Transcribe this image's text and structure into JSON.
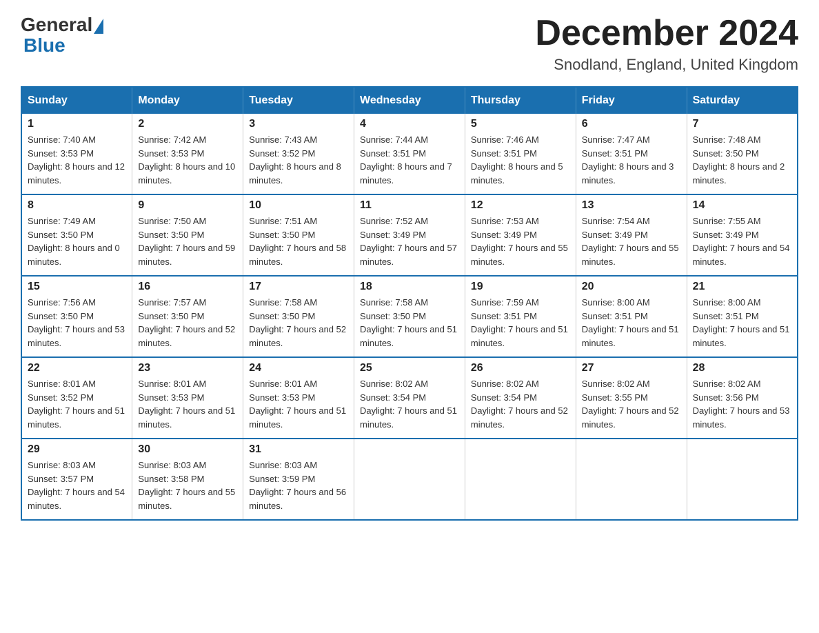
{
  "header": {
    "logo_general": "General",
    "logo_blue": "Blue",
    "title": "December 2024",
    "subtitle": "Snodland, England, United Kingdom"
  },
  "weekdays": [
    "Sunday",
    "Monday",
    "Tuesday",
    "Wednesday",
    "Thursday",
    "Friday",
    "Saturday"
  ],
  "weeks": [
    [
      {
        "day": "1",
        "sunrise": "7:40 AM",
        "sunset": "3:53 PM",
        "daylight": "8 hours and 12 minutes."
      },
      {
        "day": "2",
        "sunrise": "7:42 AM",
        "sunset": "3:53 PM",
        "daylight": "8 hours and 10 minutes."
      },
      {
        "day": "3",
        "sunrise": "7:43 AM",
        "sunset": "3:52 PM",
        "daylight": "8 hours and 8 minutes."
      },
      {
        "day": "4",
        "sunrise": "7:44 AM",
        "sunset": "3:51 PM",
        "daylight": "8 hours and 7 minutes."
      },
      {
        "day": "5",
        "sunrise": "7:46 AM",
        "sunset": "3:51 PM",
        "daylight": "8 hours and 5 minutes."
      },
      {
        "day": "6",
        "sunrise": "7:47 AM",
        "sunset": "3:51 PM",
        "daylight": "8 hours and 3 minutes."
      },
      {
        "day": "7",
        "sunrise": "7:48 AM",
        "sunset": "3:50 PM",
        "daylight": "8 hours and 2 minutes."
      }
    ],
    [
      {
        "day": "8",
        "sunrise": "7:49 AM",
        "sunset": "3:50 PM",
        "daylight": "8 hours and 0 minutes."
      },
      {
        "day": "9",
        "sunrise": "7:50 AM",
        "sunset": "3:50 PM",
        "daylight": "7 hours and 59 minutes."
      },
      {
        "day": "10",
        "sunrise": "7:51 AM",
        "sunset": "3:50 PM",
        "daylight": "7 hours and 58 minutes."
      },
      {
        "day": "11",
        "sunrise": "7:52 AM",
        "sunset": "3:49 PM",
        "daylight": "7 hours and 57 minutes."
      },
      {
        "day": "12",
        "sunrise": "7:53 AM",
        "sunset": "3:49 PM",
        "daylight": "7 hours and 55 minutes."
      },
      {
        "day": "13",
        "sunrise": "7:54 AM",
        "sunset": "3:49 PM",
        "daylight": "7 hours and 55 minutes."
      },
      {
        "day": "14",
        "sunrise": "7:55 AM",
        "sunset": "3:49 PM",
        "daylight": "7 hours and 54 minutes."
      }
    ],
    [
      {
        "day": "15",
        "sunrise": "7:56 AM",
        "sunset": "3:50 PM",
        "daylight": "7 hours and 53 minutes."
      },
      {
        "day": "16",
        "sunrise": "7:57 AM",
        "sunset": "3:50 PM",
        "daylight": "7 hours and 52 minutes."
      },
      {
        "day": "17",
        "sunrise": "7:58 AM",
        "sunset": "3:50 PM",
        "daylight": "7 hours and 52 minutes."
      },
      {
        "day": "18",
        "sunrise": "7:58 AM",
        "sunset": "3:50 PM",
        "daylight": "7 hours and 51 minutes."
      },
      {
        "day": "19",
        "sunrise": "7:59 AM",
        "sunset": "3:51 PM",
        "daylight": "7 hours and 51 minutes."
      },
      {
        "day": "20",
        "sunrise": "8:00 AM",
        "sunset": "3:51 PM",
        "daylight": "7 hours and 51 minutes."
      },
      {
        "day": "21",
        "sunrise": "8:00 AM",
        "sunset": "3:51 PM",
        "daylight": "7 hours and 51 minutes."
      }
    ],
    [
      {
        "day": "22",
        "sunrise": "8:01 AM",
        "sunset": "3:52 PM",
        "daylight": "7 hours and 51 minutes."
      },
      {
        "day": "23",
        "sunrise": "8:01 AM",
        "sunset": "3:53 PM",
        "daylight": "7 hours and 51 minutes."
      },
      {
        "day": "24",
        "sunrise": "8:01 AM",
        "sunset": "3:53 PM",
        "daylight": "7 hours and 51 minutes."
      },
      {
        "day": "25",
        "sunrise": "8:02 AM",
        "sunset": "3:54 PM",
        "daylight": "7 hours and 51 minutes."
      },
      {
        "day": "26",
        "sunrise": "8:02 AM",
        "sunset": "3:54 PM",
        "daylight": "7 hours and 52 minutes."
      },
      {
        "day": "27",
        "sunrise": "8:02 AM",
        "sunset": "3:55 PM",
        "daylight": "7 hours and 52 minutes."
      },
      {
        "day": "28",
        "sunrise": "8:02 AM",
        "sunset": "3:56 PM",
        "daylight": "7 hours and 53 minutes."
      }
    ],
    [
      {
        "day": "29",
        "sunrise": "8:03 AM",
        "sunset": "3:57 PM",
        "daylight": "7 hours and 54 minutes."
      },
      {
        "day": "30",
        "sunrise": "8:03 AM",
        "sunset": "3:58 PM",
        "daylight": "7 hours and 55 minutes."
      },
      {
        "day": "31",
        "sunrise": "8:03 AM",
        "sunset": "3:59 PM",
        "daylight": "7 hours and 56 minutes."
      },
      null,
      null,
      null,
      null
    ]
  ],
  "labels": {
    "sunrise": "Sunrise:",
    "sunset": "Sunset:",
    "daylight": "Daylight:"
  }
}
